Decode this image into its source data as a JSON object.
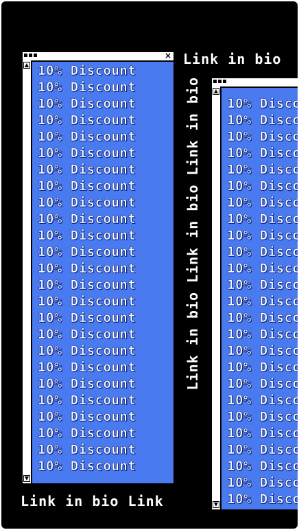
{
  "discount_text": "10% Discount",
  "left_window": {
    "row_count": 25
  },
  "right_window": {
    "row_count": 25
  },
  "ticker": {
    "top": "Link in bio",
    "vertical": "Link in bio Link in bio Link in bio",
    "bottom": "Link in bio Link"
  },
  "colors": {
    "frame": "#000000",
    "panel": "#4a7af0",
    "text": "#ffffff"
  }
}
